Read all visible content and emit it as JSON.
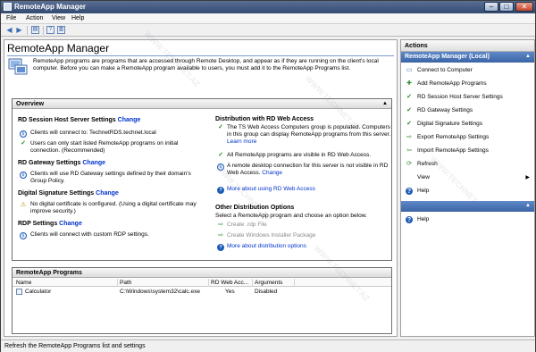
{
  "window": {
    "title": "RemoteApp Manager",
    "controls": {
      "minimize": "–",
      "maximize": "□",
      "close": "✕"
    }
  },
  "menubar": [
    "File",
    "Action",
    "View",
    "Help"
  ],
  "toolbar": {
    "icons": [
      "back-arrow-icon",
      "forward-arrow-icon",
      "console-tree-icon",
      "help-icon",
      "action-pane-icon"
    ]
  },
  "main": {
    "title": "RemoteApp Manager",
    "description": "RemoteApp programs are programs that are accessed through Remote Desktop, and appear as if they are running on the client's local computer. Before you can make a RemoteApp program available to users, you must add it to the RemoteApp Programs list."
  },
  "overview": {
    "header": "Overview",
    "rdsh": {
      "heading": "RD Session Host Server Settings",
      "link": "Change",
      "items": [
        {
          "icon": "info",
          "text": "Clients will connect to: TechnetRDS.technet.local"
        },
        {
          "icon": "check",
          "text": "Users can only start listed RemoteApp programs on initial connection. (Recommended)"
        }
      ]
    },
    "gateway": {
      "heading": "RD Gateway Settings",
      "link": "Change",
      "items": [
        {
          "icon": "info",
          "text": "Clients will use RD Gateway settings defined by their domain's Group Policy."
        }
      ]
    },
    "signature": {
      "heading": "Digital Signature Settings",
      "link": "Change",
      "items": [
        {
          "icon": "warning",
          "text": "No digital certificate is configured. (Using a digital certificate may improve security.)"
        }
      ]
    },
    "rdp": {
      "heading": "RDP Settings",
      "link": "Change",
      "items": [
        {
          "icon": "info",
          "text": "Clients will connect with custom RDP settings."
        }
      ]
    },
    "web": {
      "heading": "Distribution with RD Web Access",
      "item1": "The TS Web Access Computers group is populated. Computers in this group can display RemoteApp programs from this server.",
      "item1_link": "Learn more",
      "item2": "All RemoteApp programs are visible in RD Web Access.",
      "item3": "A remote desktop connection for this server is not visible in RD Web Access.",
      "item3_link": "Change",
      "more_link": "More about using RD Web Access"
    },
    "other": {
      "heading": "Other Distribution Options",
      "intro": "Select a RemoteApp program and choose an option below.",
      "options": [
        "Create .rdp File",
        "Create Windows Installer Package"
      ],
      "more_link": "More about distribution options"
    }
  },
  "programs": {
    "header": "RemoteApp Programs",
    "columns": [
      "Name",
      "Path",
      "RD Web Acc...",
      "Arguments"
    ],
    "rows": [
      {
        "name": "Calculator",
        "path": "C:\\Windows\\system32\\calc.exe",
        "web": "Yes",
        "args": "Disabled"
      }
    ]
  },
  "actions": {
    "title": "Actions",
    "group1": "RemoteApp Manager (Local)",
    "items": [
      {
        "label": "Connect to Computer",
        "icon": "computer-icon"
      },
      {
        "label": "Add RemoteApp Programs",
        "icon": "add-programs-icon"
      },
      {
        "label": "RD Session Host Server Settings",
        "icon": "settings-icon"
      },
      {
        "label": "RD Gateway Settings",
        "icon": "settings-icon"
      },
      {
        "label": "Digital Signature Settings",
        "icon": "settings-icon"
      },
      {
        "label": "Export RemoteApp Settings",
        "icon": "export-icon"
      },
      {
        "label": "Import RemoteApp Settings",
        "icon": "import-icon"
      },
      {
        "label": "Refresh",
        "icon": "refresh-icon"
      },
      {
        "label": "View",
        "icon": "",
        "submenu": "▶"
      },
      {
        "label": "Help",
        "icon": "help-icon"
      }
    ],
    "group2_help": "Help"
  },
  "status": "Refresh the RemoteApp Programs list and settings",
  "watermark": "WWW.TECHNET.AZ",
  "colors": {
    "accent": "#3a64a5",
    "link": "#0033cc",
    "check": "#1c8f1c",
    "warning": "#b88600"
  }
}
